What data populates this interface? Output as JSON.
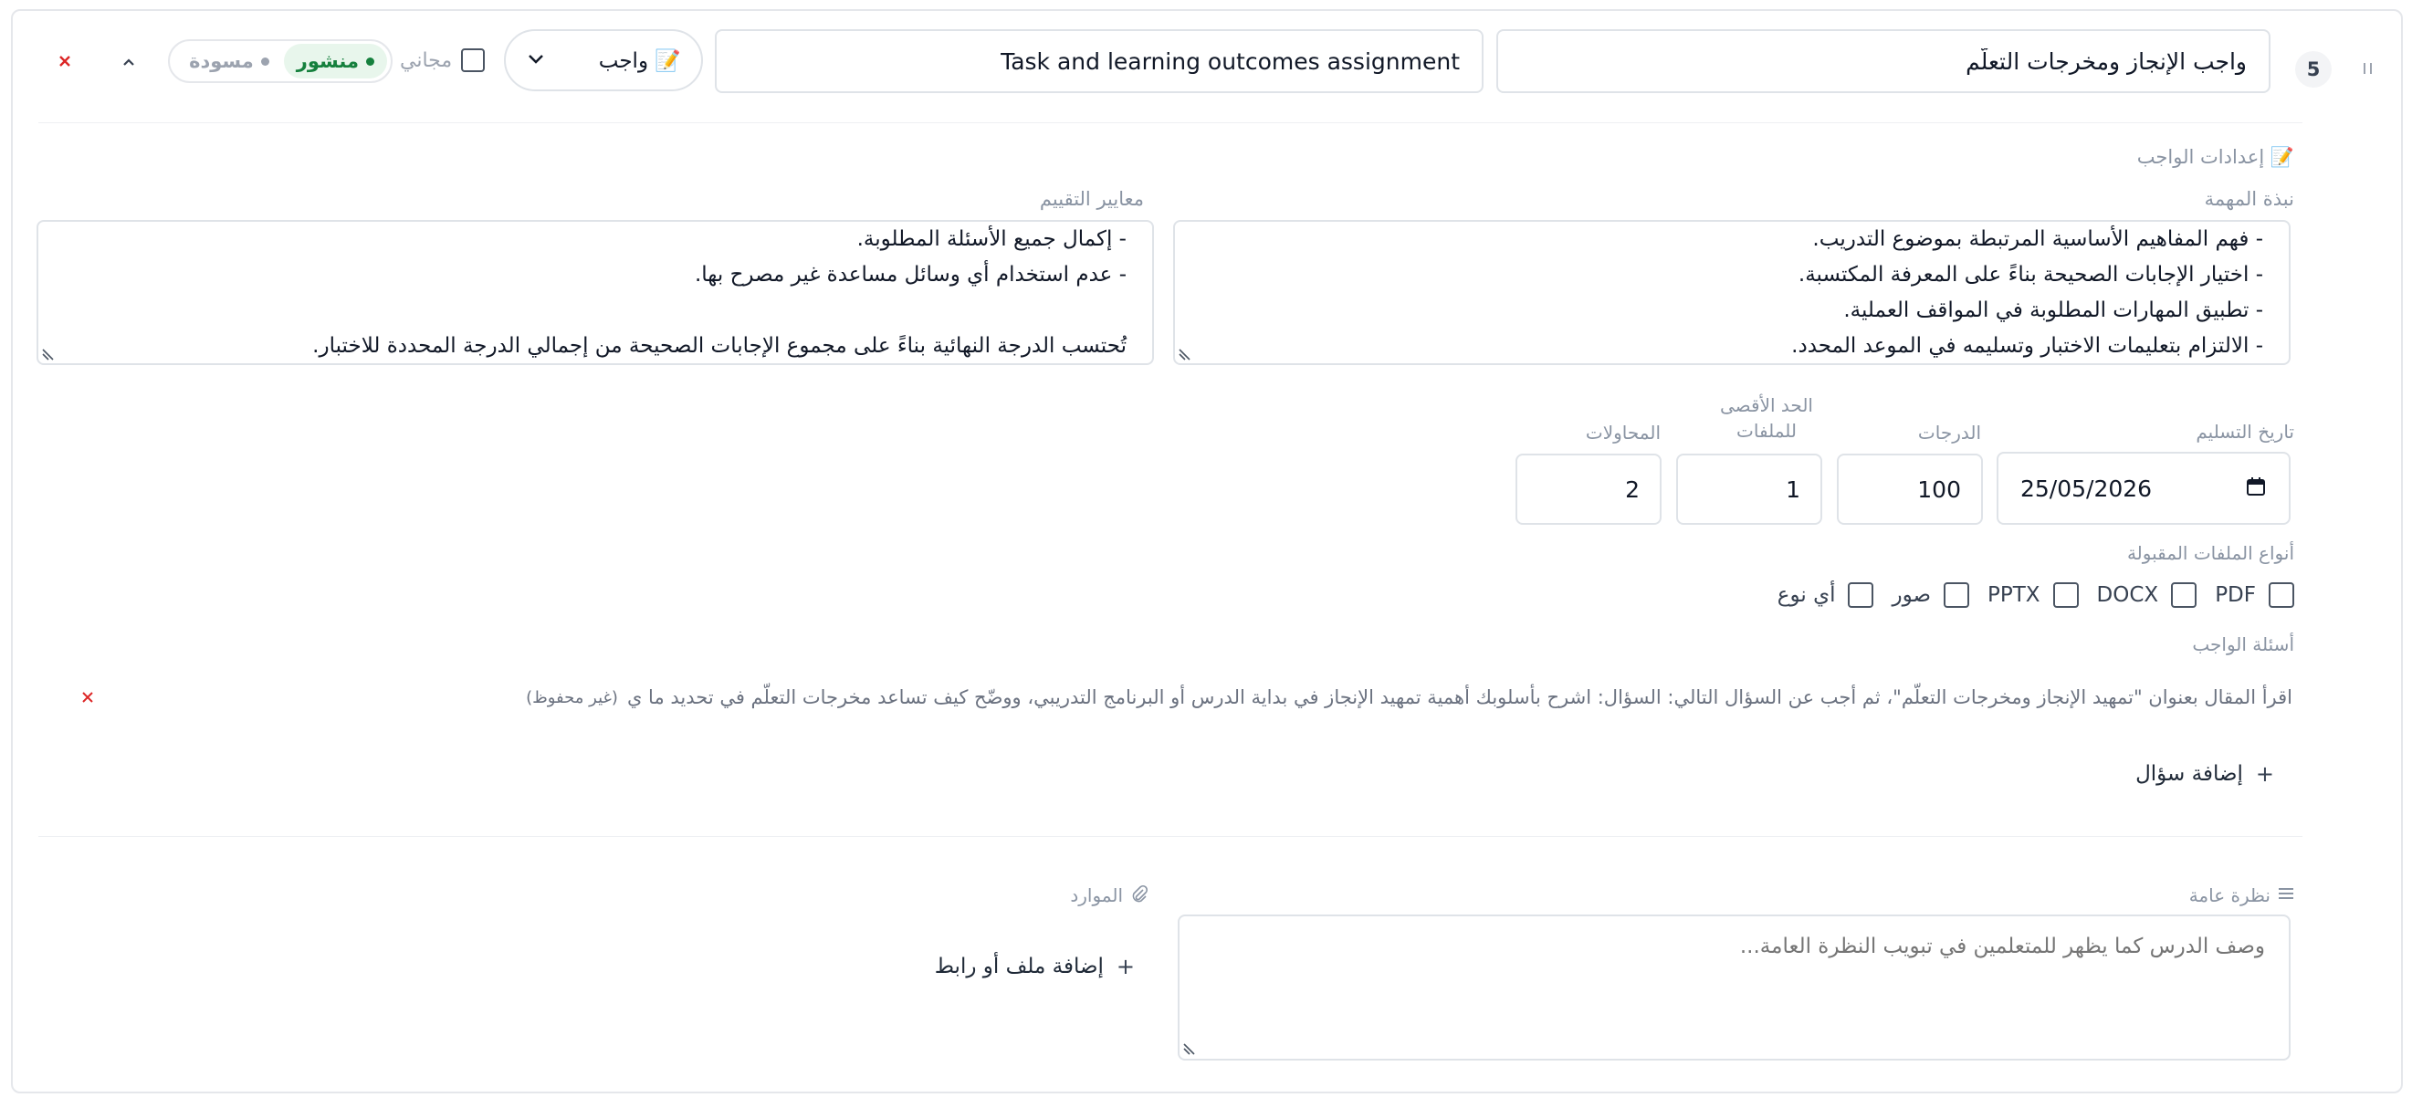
{
  "header": {
    "order_number": "5",
    "title_ar": "واجب الإنجاز ومخرجات التعلّم",
    "title_en": "Task and learning outcomes assignment",
    "type_select": "📝 واجب",
    "free_label": "مجاني",
    "status_published": "منشور",
    "status_draft": "مسودة",
    "colors": {
      "published": "#15803d",
      "published_bg": "#e8f6ec",
      "draft": "#9ca3af",
      "delete": "#dc2626"
    }
  },
  "settings": {
    "section_title": "📝 إعدادات الواجب",
    "summary_label": "نبذة المهمة",
    "summary_text": "- فهم المفاهيم الأساسية المرتبطة بموضوع التدريب.\n- اختيار الإجابات الصحيحة بناءً على المعرفة المكتسبة.\n- تطبيق المهارات المطلوبة في المواقف العملية.\n- الالتزام بتعليمات الاختبار وتسليمه في الموعد المحدد.",
    "criteria_label": "معايير التقييم",
    "criteria_text": "- إكمال جميع الأسئلة المطلوبة.\n- عدم استخدام أي وسائل مساعدة غير مصرح بها.\n\nتُحتسب الدرجة النهائية بناءً على مجموع الإجابات الصحيحة من إجمالي الدرجة المحددة للاختبار.",
    "due_date_label": "تاريخ التسليم",
    "due_date_value": "25/05/2026",
    "grades_label": "الدرجات",
    "grades_value": "100",
    "max_files_label": "الحد الأقصى للملفات",
    "max_files_value": "1",
    "attempts_label": "المحاولات",
    "attempts_value": "2",
    "file_types_label": "أنواع الملفات المقبولة",
    "file_types": [
      "PDF",
      "DOCX",
      "PPTX",
      "صور",
      "أي نوع"
    ],
    "questions_label": "أسئلة الواجب",
    "question_text": "اقرأ المقال بعنوان \"تمهيد الإنجاز ومخرجات التعلّم\"، ثم أجب عن السؤال التالي: السؤال: اشرح بأسلوبك أهمية تمهيد الإنجاز في بداية الدرس أو البرنامج التدريبي، ووضّح كيف تساعد مخرجات التعلّم في تحديد ما ي",
    "question_unsaved": "(غير محفوظ)",
    "add_question": "إضافة سؤال"
  },
  "overview": {
    "label": "نظرة عامة",
    "placeholder": "وصف الدرس كما يظهر للمتعلمين في تبويب النظرة العامة..."
  },
  "resources": {
    "label": "الموارد",
    "add_label": "إضافة ملف أو رابط"
  }
}
